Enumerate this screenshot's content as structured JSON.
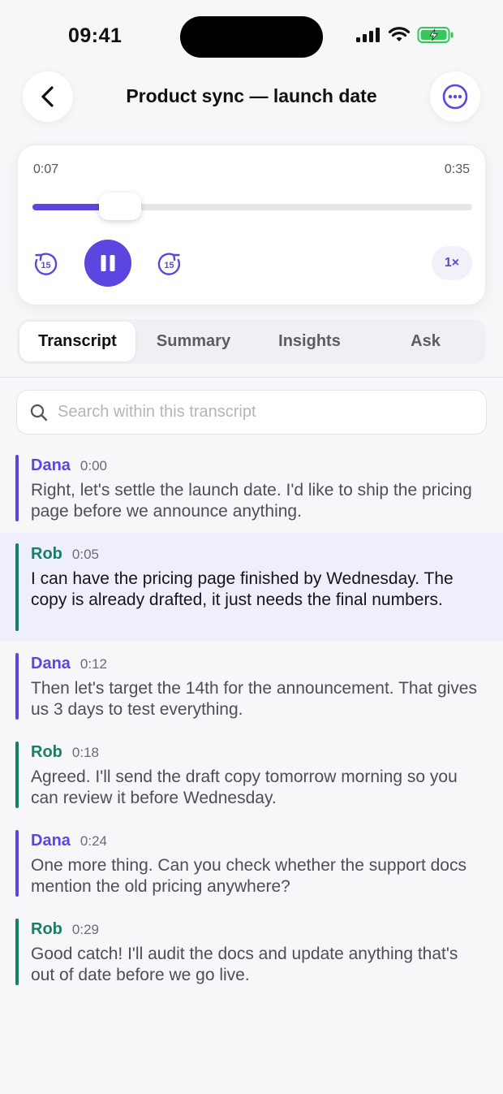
{
  "status_bar": {
    "time": "09:41"
  },
  "header": {
    "title": "Product sync — launch date"
  },
  "player": {
    "elapsed": "0:07",
    "total": "0:35",
    "progress": 0.2,
    "skip_back_label": "15",
    "skip_forward_label": "15",
    "speed": "1×",
    "state": "playing"
  },
  "tabs": [
    {
      "label": "Transcript",
      "active": true
    },
    {
      "label": "Summary",
      "active": false
    },
    {
      "label": "Insights",
      "active": false
    },
    {
      "label": "Ask",
      "active": false
    }
  ],
  "search": {
    "placeholder": "Search within this transcript",
    "value": ""
  },
  "transcript": [
    {
      "speaker": "Dana",
      "time": "0:00",
      "text": "Right, let's settle the launch date. I'd like to ship the pricing page before we announce anything.",
      "highlighted": false
    },
    {
      "speaker": "Rob",
      "time": "0:05",
      "text": "I can have the pricing page finished by Wednesday. The copy is already drafted, it just needs the final numbers.",
      "highlighted": true
    },
    {
      "speaker": "Dana",
      "time": "0:12",
      "text": "Then let's target the 14th for the announcement. That gives us 3 days to test everything.",
      "highlighted": false
    },
    {
      "speaker": "Rob",
      "time": "0:18",
      "text": "Agreed. I'll send the draft copy tomorrow morning so you can review it before Wednesday.",
      "highlighted": false
    },
    {
      "speaker": "Dana",
      "time": "0:24",
      "text": "One more thing. Can you check whether the support docs mention the old pricing anywhere?",
      "highlighted": false
    },
    {
      "speaker": "Rob",
      "time": "0:29",
      "text": "Good catch! I'll audit the docs and update anything that's out of date before we go live.",
      "highlighted": false
    }
  ],
  "colors": {
    "accent": "#5b47df",
    "speaker_dana": "#5b47df",
    "speaker_rob": "#177f66",
    "battery": "#34c759"
  }
}
